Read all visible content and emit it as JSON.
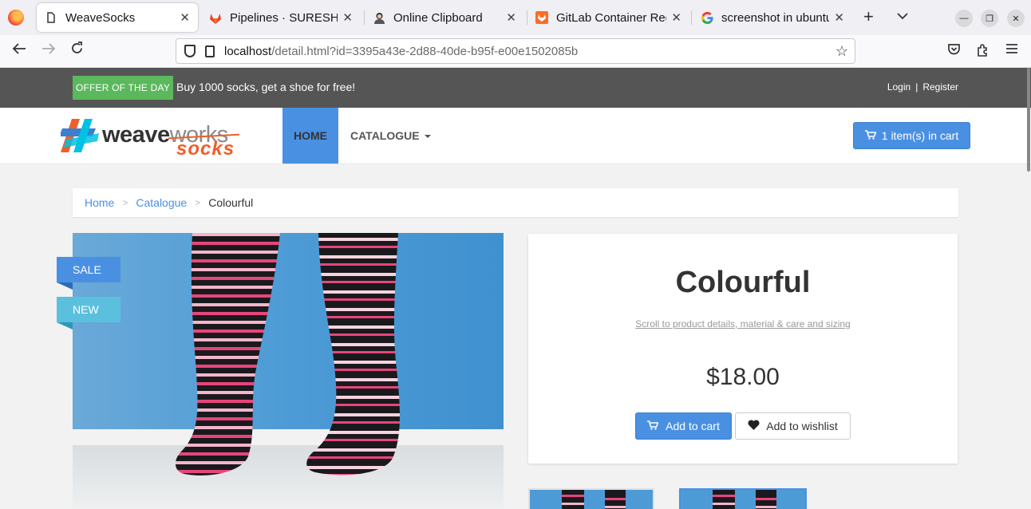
{
  "browser": {
    "tabs": [
      {
        "title": "WeaveSocks",
        "active": true,
        "icon": "page-icon"
      },
      {
        "title": "Pipelines · SURESHRA…",
        "active": false,
        "icon": "gitlab-icon"
      },
      {
        "title": "Online Clipboard",
        "active": false,
        "icon": "avatar-icon"
      },
      {
        "title": "GitLab Container Regi",
        "active": false,
        "icon": "gitlab-icon"
      },
      {
        "title": "screenshot in ubuntu -",
        "active": false,
        "icon": "google-icon"
      }
    ],
    "url_host": "localhost",
    "url_path": "/detail.html?id=3395a43e-2d88-40de-b95f-e00e1502085b"
  },
  "offer": {
    "badge": "OFFER OF THE DAY",
    "text": "Buy 1000 socks, get a shoe for free!",
    "login": "Login",
    "separator": "|",
    "register": "Register"
  },
  "header": {
    "logo_weave": "weave",
    "logo_works": "works",
    "logo_socks": "socks",
    "nav_home": "HOME",
    "nav_catalogue": "CATALOGUE",
    "cart_label": "1 item(s) in cart"
  },
  "breadcrumb": {
    "home": "Home",
    "catalogue": "Catalogue",
    "current": "Colourful",
    "sep": ">"
  },
  "product": {
    "ribbon_sale": "SALE",
    "ribbon_new": "NEW",
    "title": "Colourful",
    "scroll_link": "Scroll to product details, material & care and sizing",
    "price": "$18.00",
    "add_to_cart": "Add to cart",
    "add_to_wishlist": "Add to wishlist"
  },
  "colors": {
    "accent": "#4a90e2",
    "offer_green": "#5cb85c",
    "topbar": "#555555",
    "new_ribbon": "#5bc0de",
    "logo_orange": "#ef5f28"
  }
}
